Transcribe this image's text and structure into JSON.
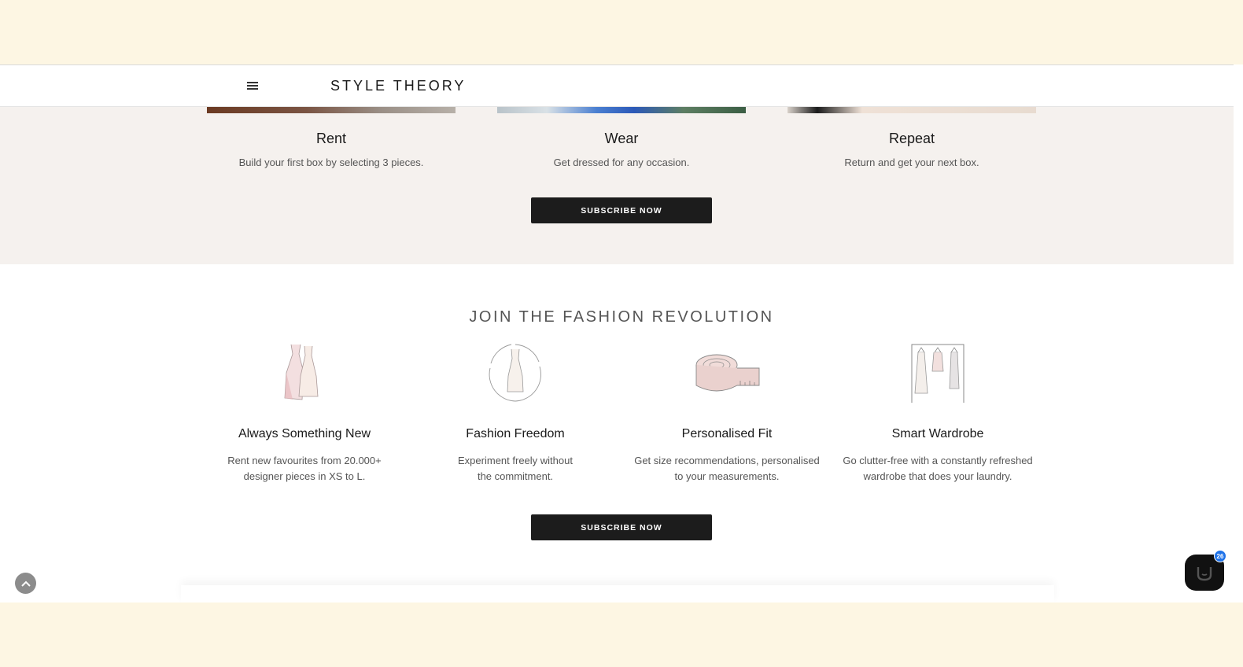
{
  "header": {
    "brand": "STYLE THEORY",
    "menu_icon": "hamburger-menu-icon"
  },
  "steps": [
    {
      "title": "Rent",
      "desc": "Build your first box by selecting 3 pieces."
    },
    {
      "title": "Wear",
      "desc": "Get dressed for any occasion."
    },
    {
      "title": "Repeat",
      "desc": "Return and get your next box."
    }
  ],
  "buttons": {
    "subscribe_1": "SUBSCRIBE NOW",
    "subscribe_2": "SUBSCRIBE NOW"
  },
  "section": {
    "title": "JOIN THE FASHION REVOLUTION"
  },
  "features": [
    {
      "title": "Always Something New",
      "desc_line1": "Rent new favourites from 20.000+",
      "desc_line2": "designer pieces in XS to L.",
      "icon": "dresses-icon"
    },
    {
      "title": "Fashion Freedom",
      "desc_line1": "Experiment freely without",
      "desc_line2": "the commitment.",
      "icon": "dress-cycle-icon"
    },
    {
      "title": "Personalised Fit",
      "desc_line1": "Get size recommendations, personalised",
      "desc_line2": "to your measurements.",
      "icon": "measuring-tape-icon"
    },
    {
      "title": "Smart Wardrobe",
      "desc_line1": "Go clutter-free with a constantly refreshed",
      "desc_line2": "wardrobe that does your laundry.",
      "icon": "clothing-rack-icon"
    }
  ],
  "chat": {
    "badge": "26",
    "icon": "chat-icon"
  },
  "back_to_top": {
    "icon": "chevron-up-icon"
  },
  "colors": {
    "band": "#fdf6e3",
    "steps_bg": "#f5f1ee",
    "button": "#1c1c1c",
    "badge": "#1e72e8"
  }
}
